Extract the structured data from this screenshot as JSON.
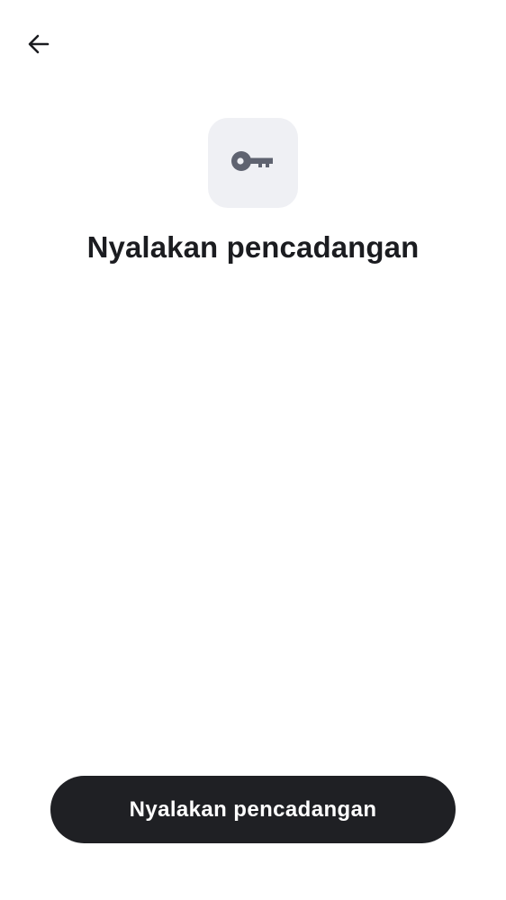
{
  "header": {
    "back_icon": "arrow-left-icon"
  },
  "hero": {
    "icon": "key-icon",
    "tile_color": "#eff0f4",
    "icon_color": "#5f6370",
    "title": "Nyalakan pencadangan"
  },
  "footer": {
    "primary_button_label": "Nyalakan pencadangan",
    "button_color": "#1f2024"
  }
}
